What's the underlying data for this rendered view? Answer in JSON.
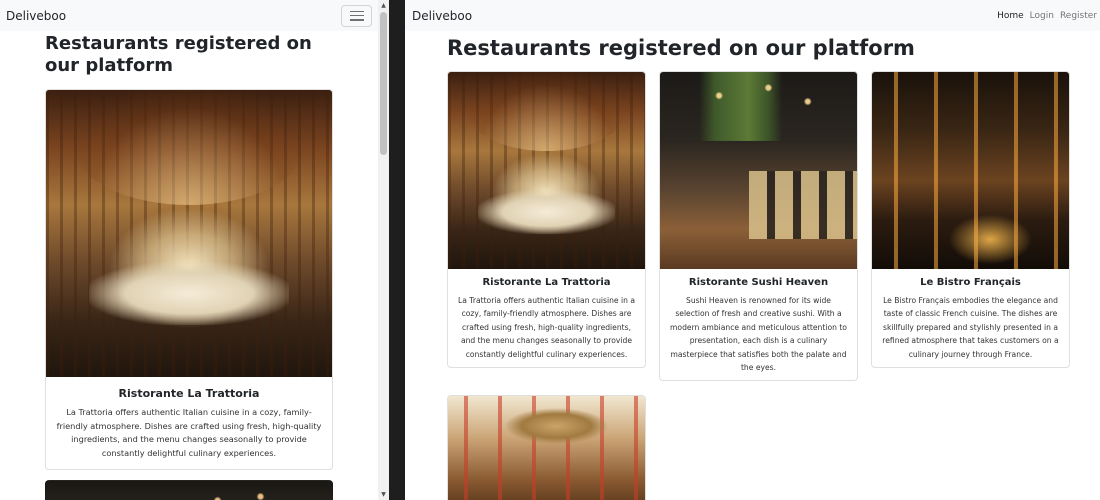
{
  "left": {
    "brand": "Deliveboo",
    "toggler_icon": "hamburger-icon",
    "heading": "Restaurants registered on our platform",
    "card": {
      "name": "Ristorante La Trattoria",
      "description": "La Trattoria offers authentic Italian cuisine in a cozy, family-friendly atmosphere. Dishes are crafted using fresh, high-quality ingredients, and the menu changes seasonally to provide constantly delightful culinary experiences."
    }
  },
  "scrollbar": {
    "up_icon": "▲",
    "down_icon": "▼"
  },
  "right": {
    "brand": "Deliveboo",
    "nav": {
      "home": "Home",
      "login": "Login",
      "register": "Register"
    },
    "heading": "Restaurants registered on our platform",
    "restaurants": [
      {
        "name": "Ristorante La Trattoria",
        "description": "La Trattoria offers authentic Italian cuisine in a cozy, family-friendly atmosphere. Dishes are crafted using fresh, high-quality ingredients, and the menu changes seasonally to provide constantly delightful culinary experiences."
      },
      {
        "name": "Ristorante Sushi Heaven",
        "description": "Sushi Heaven is renowned for its wide selection of fresh and creative sushi. With a modern ambiance and meticulous attention to presentation, each dish is a culinary masterpiece that satisfies both the palate and the eyes."
      },
      {
        "name": "Le Bistro Français",
        "description": "Le Bistro Français embodies the elegance and taste of classic French cuisine. The dishes are skillfully prepared and stylishly presented in a refined atmosphere that takes customers on a culinary journey through France."
      }
    ]
  }
}
